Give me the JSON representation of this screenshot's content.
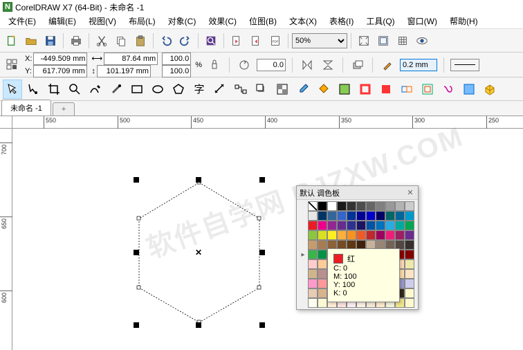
{
  "title": "CorelDRAW X7 (64-Bit) - 未命名 -1",
  "menu": {
    "file": "文件(E)",
    "edit": "编辑(E)",
    "view": "视图(V)",
    "layout": "布局(L)",
    "object": "对象(C)",
    "effects": "效果(C)",
    "bitmap": "位图(B)",
    "text": "文本(X)",
    "table": "表格(I)",
    "tools": "工具(Q)",
    "window": "窗口(W)",
    "help": "帮助(H)"
  },
  "zoom": "50%",
  "prop": {
    "x": "-449.509 mm",
    "y": "617.709 mm",
    "w": "87.64 mm",
    "h": "101.197 mm",
    "sx": "100.0",
    "sy": "100.0",
    "pct": "%",
    "rot": "0.0",
    "outline": "0.2 mm"
  },
  "tab": {
    "name": "未命名 -1",
    "plus": "+"
  },
  "ruler_h": [
    "550",
    "500",
    "450",
    "400",
    "350",
    "300",
    "250"
  ],
  "ruler_v": [
    "700",
    "650",
    "600"
  ],
  "palette": {
    "title": "默认 调色板",
    "tooltip": {
      "name": "红",
      "c": "C: 0",
      "m": "M: 100",
      "y": "Y: 100",
      "k": "K: 0",
      "color": "#ed1c24"
    },
    "colors": [
      "none",
      "#000000",
      "#ffffff",
      "#1a1a1a",
      "#333333",
      "#4d4d4d",
      "#666666",
      "#808080",
      "#999999",
      "#b3b3b3",
      "#cccccc",
      "#e6e6e6",
      "#003366",
      "#336699",
      "#3366cc",
      "#003399",
      "#000099",
      "#0000cc",
      "#000066",
      "#006666",
      "#006699",
      "#0099cc",
      "#ed1c24",
      "#ec008c",
      "#92278f",
      "#662d91",
      "#2e3192",
      "#1b1464",
      "#0054a6",
      "#0071bc",
      "#29abe2",
      "#00a99d",
      "#00a651",
      "#8cc63f",
      "#d9e021",
      "#fcee21",
      "#fbb03b",
      "#f7931e",
      "#f15a24",
      "#c1272d",
      "#9e005d",
      "#ed1e79",
      "#9e1f63",
      "#6b2c91",
      "#c69c6d",
      "#a67c52",
      "#8c6239",
      "#754c24",
      "#603813",
      "#42210b",
      "#c7b299",
      "#998675",
      "#736357",
      "#534741",
      "#362f2d",
      "#39b54a",
      "#009245",
      "#006837",
      "#598527",
      "#fff200",
      "#f7941d",
      "#ef4136",
      "#ce2029",
      "#b0171f",
      "#8b0000",
      "#800000",
      "#ffcccc",
      "#ffcc99",
      "#ffff99",
      "#ccffcc",
      "#99ffff",
      "#ccccff",
      "#ffccff",
      "#f5deb3",
      "#ffe4b5",
      "#ffdab9",
      "#eee8aa",
      "#d2b48c",
      "#bc8f8f",
      "#f4a460",
      "#daa520",
      "#cd853f",
      "#d2691e",
      "#a0522d",
      "#8b4513",
      "#deb887",
      "#ffdead",
      "#ffe4c4",
      "#ff99cc",
      "#ff9999",
      "#ff6666",
      "#ff6699",
      "#cc6699",
      "#cc9999",
      "#996666",
      "#cc99cc",
      "#9966cc",
      "#9999cc",
      "#ccccee",
      "#e6ccb3",
      "#d9b38c",
      "#cc9966",
      "#bf8040",
      "#b26b1a",
      "#996633",
      "#806040",
      "#665033",
      "#4d3d26",
      "#33291a",
      "#fffacd",
      "#fffff0",
      "#fafad2",
      "#ffefd5",
      "#ffe4e1",
      "#fff0f5",
      "#fdf5e6",
      "#faebd7",
      "#ffebcd",
      "#f5f5dc",
      "#f0e68c",
      "#fffacd"
    ]
  },
  "watermark": "软件自学网 RJZXW.COM"
}
